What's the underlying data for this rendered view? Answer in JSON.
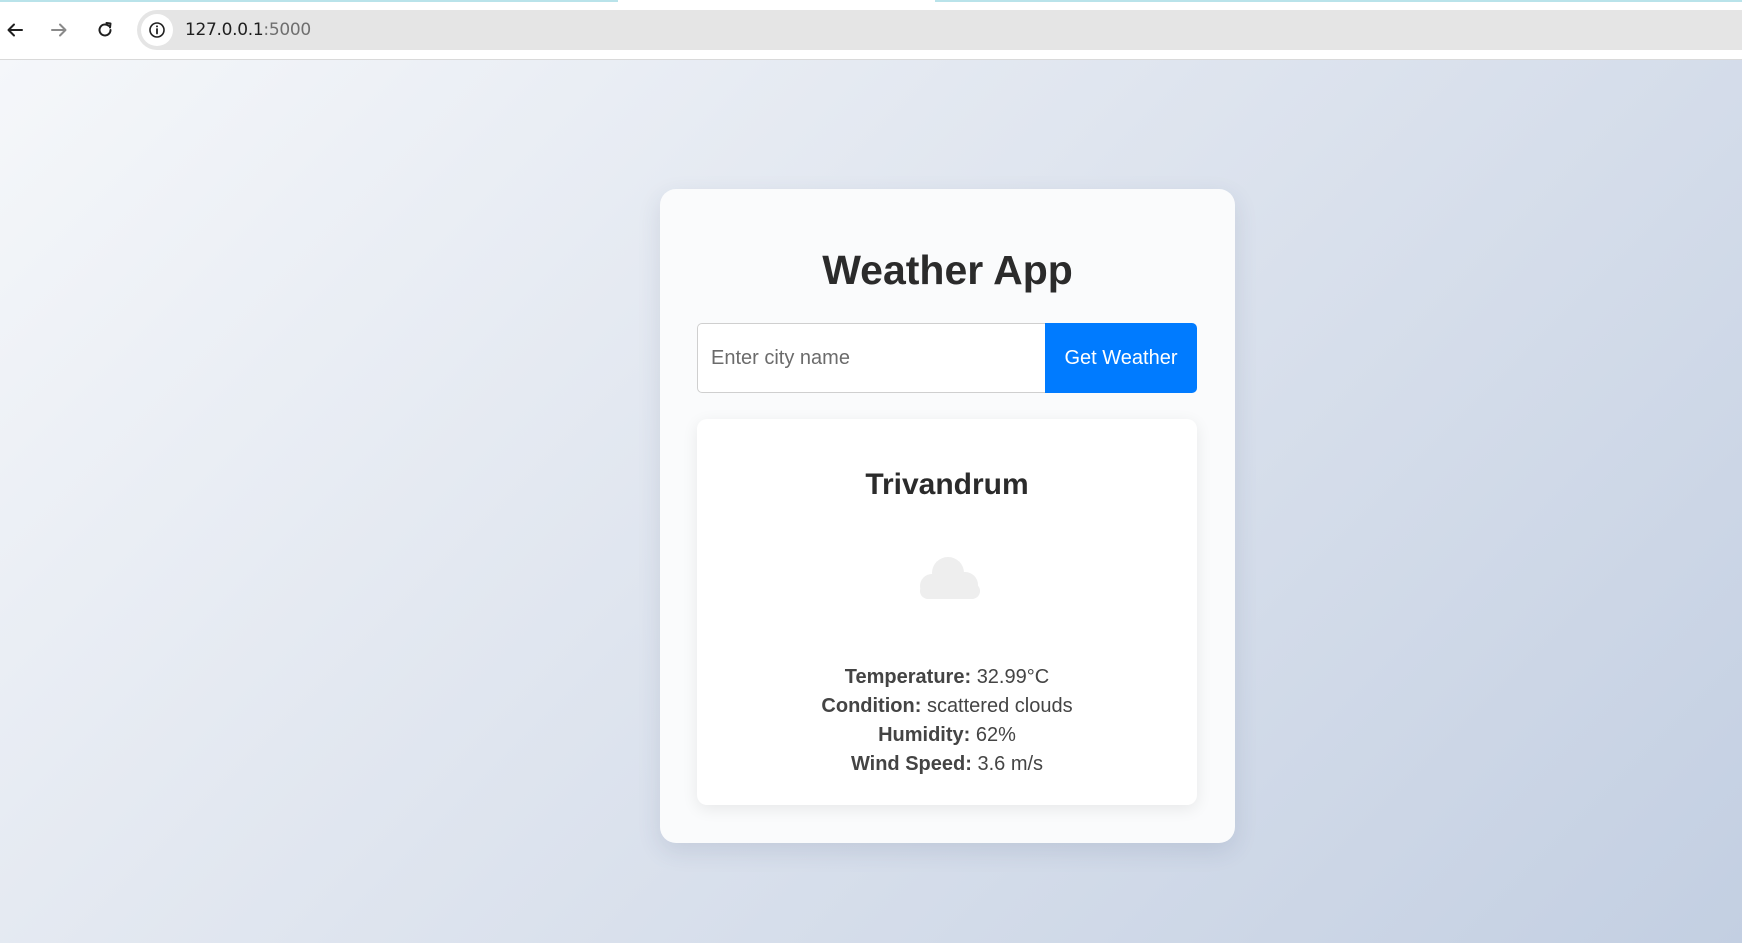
{
  "browser": {
    "url_host": "127.0.0.1",
    "url_port": ":5000",
    "icons": {
      "back": "arrow-left-icon",
      "forward": "arrow-right-icon",
      "reload": "reload-icon",
      "site_info": "info-circle-icon"
    }
  },
  "app": {
    "title": "Weather App",
    "search": {
      "placeholder": "Enter city name",
      "value": "",
      "button_label": "Get Weather"
    },
    "result": {
      "city": "Trivandrum",
      "icon": "cloud-icon",
      "details": [
        {
          "label": "Temperature:",
          "value": "32.99°C"
        },
        {
          "label": "Condition:",
          "value": "scattered clouds"
        },
        {
          "label": "Humidity:",
          "value": "62%"
        },
        {
          "label": "Wind Speed:",
          "value": "3.6 m/s"
        }
      ]
    }
  },
  "colors": {
    "accent": "#007bff",
    "background_start": "#f5f7fa",
    "background_end": "#c3cfe2",
    "card_background": "#ffffff",
    "icon_gray": "#eeeeee"
  }
}
